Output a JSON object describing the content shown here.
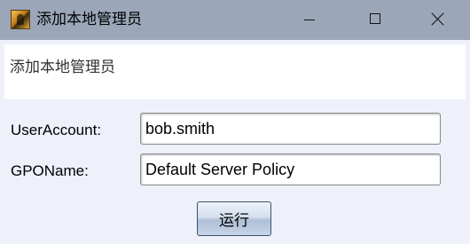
{
  "window": {
    "title": "添加本地管理员",
    "icon": "app-icon"
  },
  "banner": {
    "text": "添加本地管理员"
  },
  "form": {
    "user_account_label": "UserAccount:",
    "user_account_value": "bob.smith",
    "gpo_name_label": "GPOName:",
    "gpo_name_value": "Default Server Policy"
  },
  "actions": {
    "run_label": "运行"
  },
  "colors": {
    "titlebar": "#9ba7b9",
    "background": "#eef0fa",
    "banner": "#ffffff"
  }
}
